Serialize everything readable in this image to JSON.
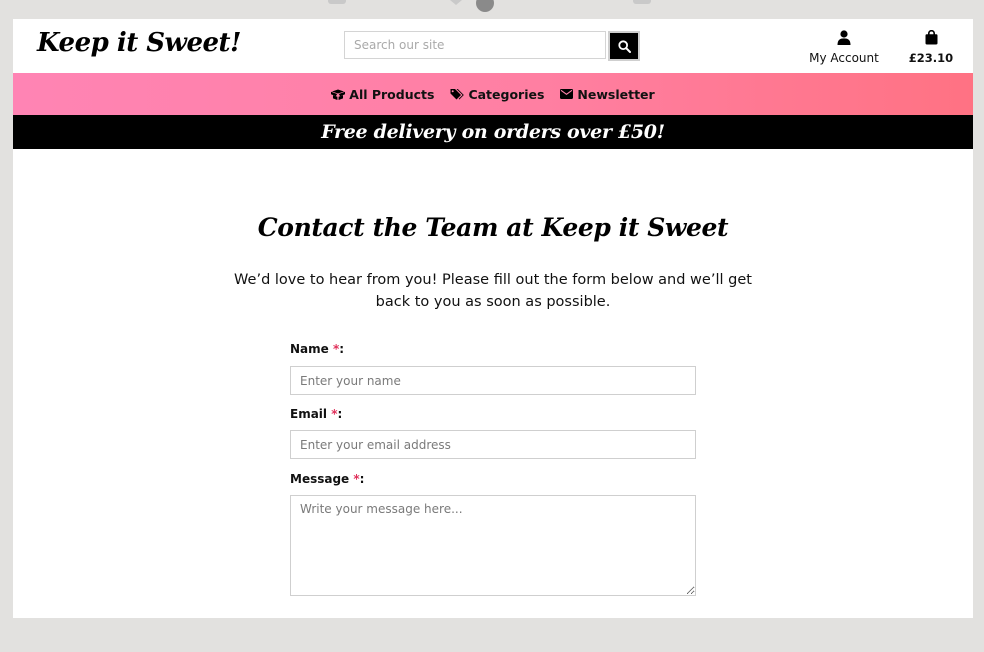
{
  "brand": {
    "logo_text": "Keep it Sweet!"
  },
  "search": {
    "placeholder": "Search our site",
    "button_icon": "search-icon"
  },
  "account": {
    "label": "My Account",
    "icon": "user-icon"
  },
  "bag": {
    "total": "£23.10",
    "icon": "shopping-bag-icon"
  },
  "nav": {
    "items": [
      {
        "label": "All Products",
        "icon": "box-open-icon"
      },
      {
        "label": "Categories",
        "icon": "tags-icon"
      },
      {
        "label": "Newsletter",
        "icon": "envelope-icon"
      }
    ]
  },
  "promo": {
    "text": "Free delivery on orders over £50!"
  },
  "page": {
    "title": "Contact the Team at Keep it Sweet",
    "intro": "We’d love to hear from you! Please fill out the form below and we’ll get back to you as soon as possible."
  },
  "form": {
    "required_marker": "*",
    "name": {
      "label": "Name",
      "placeholder": "Enter your name"
    },
    "email": {
      "label": "Email",
      "placeholder": "Enter your email address"
    },
    "message": {
      "label": "Message",
      "placeholder": "Write your message here..."
    }
  },
  "colors": {
    "nav_gradient_start": "#ff84b4",
    "nav_gradient_end": "#ff7283",
    "promo_bg": "#000000",
    "required": "#e0305a",
    "page_bg": "#e2e1df"
  }
}
